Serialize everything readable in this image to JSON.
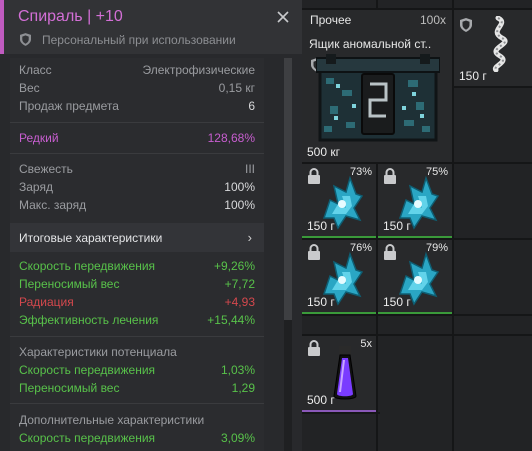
{
  "tooltip": {
    "title": "Спираль | +10",
    "subtitle": "Персональный при использовании",
    "basic": [
      {
        "k": "Класс",
        "v": "Электрофизические"
      },
      {
        "k": "Вес",
        "v": "0,15 кг"
      },
      {
        "k": "Продаж предмета",
        "v": "6"
      }
    ],
    "rarity": {
      "k": "Редкий",
      "v": "128,68%"
    },
    "condition": [
      {
        "k": "Свежесть",
        "v": "III"
      },
      {
        "k": "Заряд",
        "v": "100%"
      },
      {
        "k": "Макс. заряд",
        "v": "100%"
      }
    ],
    "aggregate_label": "Итоговые характеристики",
    "aggregate_chevron": "›",
    "stats": [
      {
        "k": "Скорость передвижения",
        "v": "+9,26%",
        "tone": "green"
      },
      {
        "k": "Переносимый вес",
        "v": "+7,72",
        "tone": "green"
      },
      {
        "k": "Радиация",
        "v": "+4,93",
        "tone": "red"
      },
      {
        "k": "Эффективность лечения",
        "v": "+15,44%",
        "tone": "green"
      }
    ],
    "potential_title": "Характеристики потенциала",
    "potential": [
      {
        "k": "Скорость передвижения",
        "v": "1,03%"
      },
      {
        "k": "Переносимый вес",
        "v": "1,29"
      }
    ],
    "extra_title": "Дополнительные характеристики",
    "extra": [
      {
        "k": "Скорость передвижения",
        "v": "3,09%"
      }
    ]
  },
  "inventory": {
    "box": {
      "category": "Прочее",
      "count": "100x",
      "name": "Ящик аномальной ст..",
      "weight": "500 кг"
    },
    "spiral_top": {
      "weight": "150 г"
    },
    "crystals": [
      {
        "pct": "73%",
        "weight": "150 г"
      },
      {
        "pct": "75%",
        "weight": "150 г"
      },
      {
        "pct": "76%",
        "weight": "150 г"
      },
      {
        "pct": "79%",
        "weight": "150 г"
      }
    ],
    "vial": {
      "count": "5x",
      "weight": "500 г"
    }
  },
  "colors": {
    "rare": "#c85ed0",
    "positive": "#58c24a",
    "negative": "#d4484d"
  }
}
